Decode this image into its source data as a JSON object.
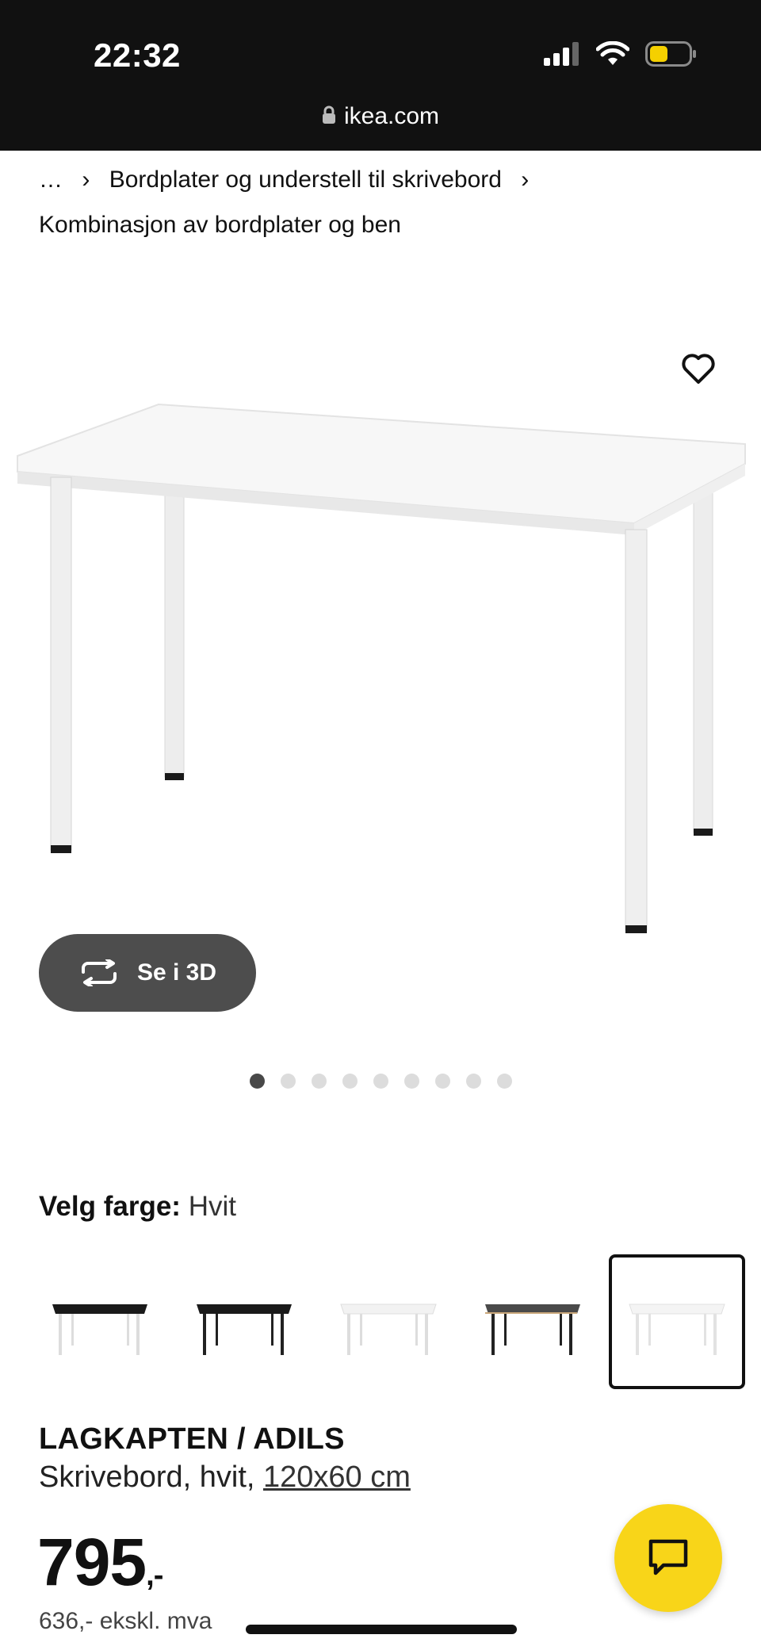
{
  "status_bar": {
    "time": "22:32",
    "icons": [
      "signal-icon",
      "wifi-icon",
      "battery-icon"
    ],
    "battery_color": "#f5d000"
  },
  "browser": {
    "url": "ikea.com"
  },
  "breadcrumb": {
    "ellipsis": "…",
    "item": "Bordplater og understell til skrivebord",
    "current": "Kombinasjon av bordplater og ben"
  },
  "hero": {
    "view_3d_label": "Se i 3D",
    "slide_count": 9,
    "active_slide": 1
  },
  "color_select": {
    "label": "Velg farge:",
    "value": "Hvit",
    "options": [
      {
        "top": "#1a1a1a",
        "legs": "#ffffff"
      },
      {
        "top": "#1a1a1a",
        "legs": "#1a1a1a"
      },
      {
        "top": "#f4f4f4",
        "legs": "#ffffff"
      },
      {
        "top": "#4a4a4a",
        "legs": "#1a1a1a"
      },
      {
        "top": "#f4f4f4",
        "legs": "#ffffff",
        "selected": true
      }
    ]
  },
  "product": {
    "name": "LAGKAPTEN / ADILS",
    "desc_prefix": "Skrivebord, hvit, ",
    "size": "120x60 cm",
    "price": "795",
    "price_suffix": ",-",
    "price_ex_vat": "636,- ekskl. mva"
  },
  "colors": {
    "accent_yellow": "#f8d519",
    "dark": "#111111",
    "button_gray": "#4d4d4d"
  }
}
